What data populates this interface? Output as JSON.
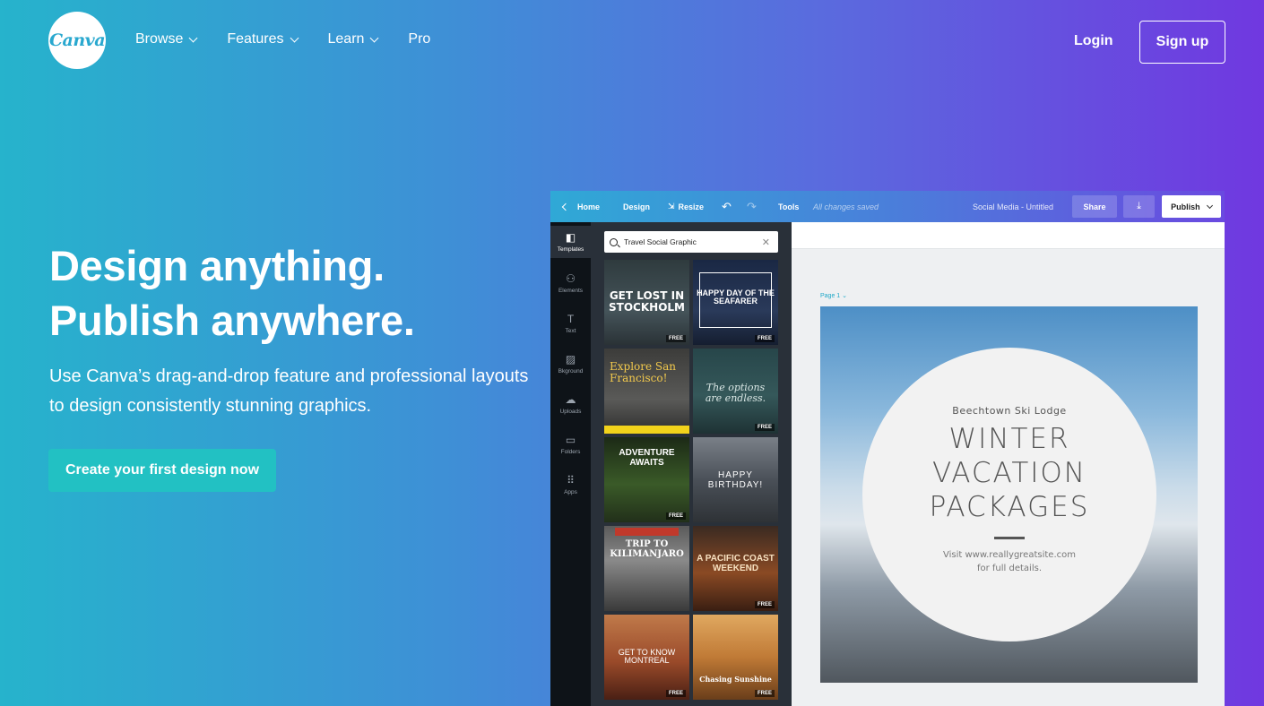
{
  "brand": {
    "logo_text": "Canva"
  },
  "nav": {
    "items": [
      {
        "label": "Browse",
        "has_dropdown": true
      },
      {
        "label": "Features",
        "has_dropdown": true
      },
      {
        "label": "Learn",
        "has_dropdown": true
      },
      {
        "label": "Pro",
        "has_dropdown": false
      }
    ],
    "login": "Login",
    "signup": "Sign up"
  },
  "hero": {
    "title_line1": "Design anything.",
    "title_line2": "Publish anywhere.",
    "subtitle": "Use Canva’s drag-and-drop feature and professional layouts to design consistently stunning graphics.",
    "cta": "Create your first design now"
  },
  "editor": {
    "toolbar": {
      "home": "Home",
      "design": "Design",
      "resize": "Resize",
      "tools": "Tools",
      "status": "All changes saved",
      "doc_title": "Social Media - Untitled",
      "share": "Share",
      "publish": "Publish"
    },
    "sidebar": [
      {
        "label": "Templates",
        "icon": "templates-icon"
      },
      {
        "label": "Elements",
        "icon": "elements-icon"
      },
      {
        "label": "Text",
        "icon": "text-icon"
      },
      {
        "label": "Bkground",
        "icon": "background-icon"
      },
      {
        "label": "Uploads",
        "icon": "upload-icon"
      },
      {
        "label": "Folders",
        "icon": "folder-icon"
      },
      {
        "label": "Apps",
        "icon": "apps-icon"
      }
    ],
    "search": {
      "value": "Travel Social Graphic"
    },
    "templates": [
      {
        "text": "GET LOST IN STOCKHOLM",
        "free": "FREE",
        "bg": "#3a4a4e"
      },
      {
        "text": "HAPPY DAY OF THE SEAFARER",
        "free": "FREE",
        "bg": "#1d2b45"
      },
      {
        "text": "Explore San Francisco!",
        "free": "",
        "bg": "#4a4a48"
      },
      {
        "text": "The options are endless.",
        "free": "FREE",
        "bg": "#2f4b4e"
      },
      {
        "text": "ADVENTURE AWAITS",
        "free": "FREE",
        "bg": "#2b3a22"
      },
      {
        "text": "HAPPY BIRTHDAY!",
        "free": "",
        "bg": "#5a5f66"
      },
      {
        "text": "TRIP TO KILIMANJARO",
        "free": "",
        "bg": "#6b6b6b"
      },
      {
        "text": "A PACIFIC COAST WEEKEND",
        "free": "FREE",
        "bg": "#7a3a1c"
      },
      {
        "text": "GET TO KNOW MONTREAL",
        "free": "FREE",
        "bg": "#8a3c2a"
      },
      {
        "text": "Chasing Sunshine",
        "free": "FREE",
        "bg": "#c98a3a"
      }
    ],
    "page_label": "Page 1",
    "design": {
      "subtitle": "Beechtown Ski Lodge",
      "title": "WINTER VACATION PACKAGES",
      "footer_line1": "Visit www.reallygreatsite.com",
      "footer_line2": "for full details."
    }
  }
}
